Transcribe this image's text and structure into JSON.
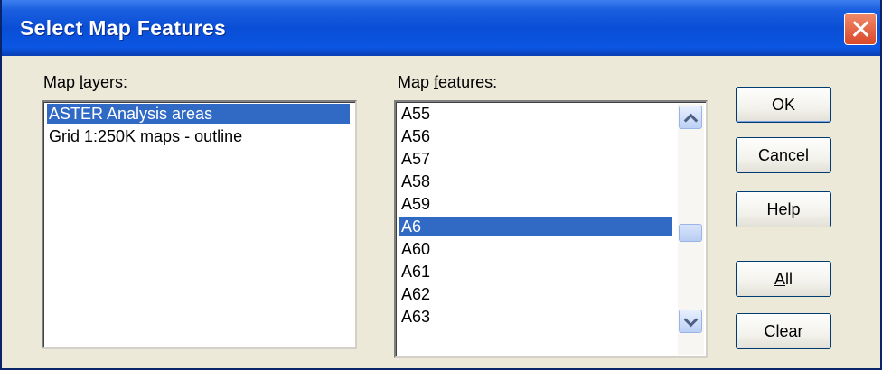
{
  "window": {
    "title": "Select Map Features"
  },
  "layers": {
    "label": "Map layers:",
    "items": [
      "ASTER Analysis areas",
      "Grid 1:250K maps - outline"
    ],
    "selected_index": 0
  },
  "features": {
    "label": "Map features:",
    "items": [
      "A55",
      "A56",
      "A57",
      "A58",
      "A59",
      "A6",
      "A60",
      "A61",
      "A62",
      "A63"
    ],
    "selected_index": 5
  },
  "buttons": {
    "ok": "OK",
    "cancel": "Cancel",
    "help": "Help",
    "all": "All",
    "clear": "Clear"
  },
  "colors": {
    "selection": "#316ac5",
    "titlebar": "#0a4ed6",
    "dialog_bg": "#ece9d8"
  }
}
